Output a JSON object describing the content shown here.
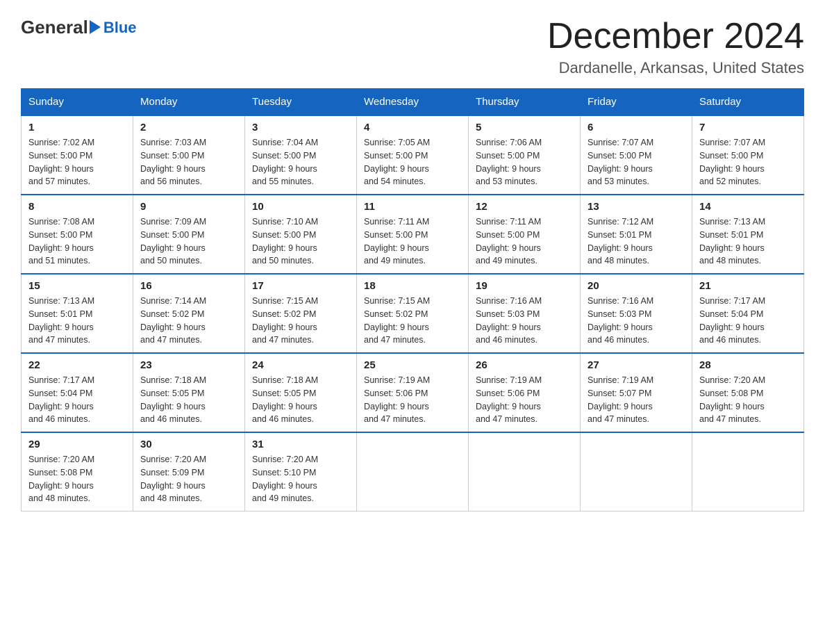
{
  "header": {
    "logo_general": "General",
    "logo_blue": "Blue",
    "month_title": "December 2024",
    "location": "Dardanelle, Arkansas, United States"
  },
  "days_of_week": [
    "Sunday",
    "Monday",
    "Tuesday",
    "Wednesday",
    "Thursday",
    "Friday",
    "Saturday"
  ],
  "weeks": [
    [
      {
        "day": "1",
        "sunrise": "7:02 AM",
        "sunset": "5:00 PM",
        "daylight": "9 hours and 57 minutes."
      },
      {
        "day": "2",
        "sunrise": "7:03 AM",
        "sunset": "5:00 PM",
        "daylight": "9 hours and 56 minutes."
      },
      {
        "day": "3",
        "sunrise": "7:04 AM",
        "sunset": "5:00 PM",
        "daylight": "9 hours and 55 minutes."
      },
      {
        "day": "4",
        "sunrise": "7:05 AM",
        "sunset": "5:00 PM",
        "daylight": "9 hours and 54 minutes."
      },
      {
        "day": "5",
        "sunrise": "7:06 AM",
        "sunset": "5:00 PM",
        "daylight": "9 hours and 53 minutes."
      },
      {
        "day": "6",
        "sunrise": "7:07 AM",
        "sunset": "5:00 PM",
        "daylight": "9 hours and 53 minutes."
      },
      {
        "day": "7",
        "sunrise": "7:07 AM",
        "sunset": "5:00 PM",
        "daylight": "9 hours and 52 minutes."
      }
    ],
    [
      {
        "day": "8",
        "sunrise": "7:08 AM",
        "sunset": "5:00 PM",
        "daylight": "9 hours and 51 minutes."
      },
      {
        "day": "9",
        "sunrise": "7:09 AM",
        "sunset": "5:00 PM",
        "daylight": "9 hours and 50 minutes."
      },
      {
        "day": "10",
        "sunrise": "7:10 AM",
        "sunset": "5:00 PM",
        "daylight": "9 hours and 50 minutes."
      },
      {
        "day": "11",
        "sunrise": "7:11 AM",
        "sunset": "5:00 PM",
        "daylight": "9 hours and 49 minutes."
      },
      {
        "day": "12",
        "sunrise": "7:11 AM",
        "sunset": "5:00 PM",
        "daylight": "9 hours and 49 minutes."
      },
      {
        "day": "13",
        "sunrise": "7:12 AM",
        "sunset": "5:01 PM",
        "daylight": "9 hours and 48 minutes."
      },
      {
        "day": "14",
        "sunrise": "7:13 AM",
        "sunset": "5:01 PM",
        "daylight": "9 hours and 48 minutes."
      }
    ],
    [
      {
        "day": "15",
        "sunrise": "7:13 AM",
        "sunset": "5:01 PM",
        "daylight": "9 hours and 47 minutes."
      },
      {
        "day": "16",
        "sunrise": "7:14 AM",
        "sunset": "5:02 PM",
        "daylight": "9 hours and 47 minutes."
      },
      {
        "day": "17",
        "sunrise": "7:15 AM",
        "sunset": "5:02 PM",
        "daylight": "9 hours and 47 minutes."
      },
      {
        "day": "18",
        "sunrise": "7:15 AM",
        "sunset": "5:02 PM",
        "daylight": "9 hours and 47 minutes."
      },
      {
        "day": "19",
        "sunrise": "7:16 AM",
        "sunset": "5:03 PM",
        "daylight": "9 hours and 46 minutes."
      },
      {
        "day": "20",
        "sunrise": "7:16 AM",
        "sunset": "5:03 PM",
        "daylight": "9 hours and 46 minutes."
      },
      {
        "day": "21",
        "sunrise": "7:17 AM",
        "sunset": "5:04 PM",
        "daylight": "9 hours and 46 minutes."
      }
    ],
    [
      {
        "day": "22",
        "sunrise": "7:17 AM",
        "sunset": "5:04 PM",
        "daylight": "9 hours and 46 minutes."
      },
      {
        "day": "23",
        "sunrise": "7:18 AM",
        "sunset": "5:05 PM",
        "daylight": "9 hours and 46 minutes."
      },
      {
        "day": "24",
        "sunrise": "7:18 AM",
        "sunset": "5:05 PM",
        "daylight": "9 hours and 46 minutes."
      },
      {
        "day": "25",
        "sunrise": "7:19 AM",
        "sunset": "5:06 PM",
        "daylight": "9 hours and 47 minutes."
      },
      {
        "day": "26",
        "sunrise": "7:19 AM",
        "sunset": "5:06 PM",
        "daylight": "9 hours and 47 minutes."
      },
      {
        "day": "27",
        "sunrise": "7:19 AM",
        "sunset": "5:07 PM",
        "daylight": "9 hours and 47 minutes."
      },
      {
        "day": "28",
        "sunrise": "7:20 AM",
        "sunset": "5:08 PM",
        "daylight": "9 hours and 47 minutes."
      }
    ],
    [
      {
        "day": "29",
        "sunrise": "7:20 AM",
        "sunset": "5:08 PM",
        "daylight": "9 hours and 48 minutes."
      },
      {
        "day": "30",
        "sunrise": "7:20 AM",
        "sunset": "5:09 PM",
        "daylight": "9 hours and 48 minutes."
      },
      {
        "day": "31",
        "sunrise": "7:20 AM",
        "sunset": "5:10 PM",
        "daylight": "9 hours and 49 minutes."
      },
      null,
      null,
      null,
      null
    ]
  ]
}
